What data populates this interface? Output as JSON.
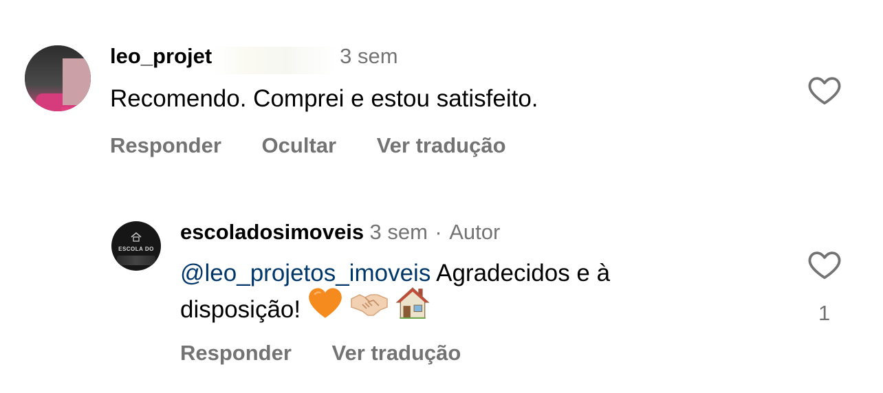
{
  "comments": [
    {
      "username": "leo_projet",
      "time": "3 sem",
      "text": "Recomendo. Comprei e estou satisfeito.",
      "actions": {
        "reply": "Responder",
        "hide": "Ocultar",
        "translate": "Ver tradução"
      }
    }
  ],
  "reply": {
    "username": "escoladosimoveis",
    "time": "3 sem",
    "author_badge": "Autor",
    "separator": "·",
    "mention": "@leo_projetos_imoveis",
    "text_line1": " Agradecidos e à",
    "text_line2": "disposição! ",
    "emojis": [
      "orange-heart",
      "handshake",
      "house"
    ],
    "like_count": "1",
    "actions": {
      "reply": "Responder",
      "translate": "Ver tradução"
    },
    "avatar_text": "ESCOLA DO"
  },
  "colors": {
    "meta": "#737373",
    "mention": "#00376b",
    "orange": "#F58A1F"
  }
}
